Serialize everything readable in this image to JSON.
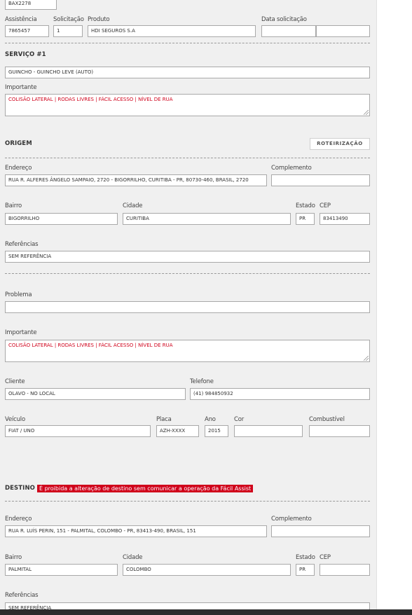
{
  "top": {
    "code": "BAX2278"
  },
  "header": {
    "assistencia_label": "Assistência",
    "assistencia_value": "7865457",
    "solicitacao_label": "Solicitação",
    "solicitacao_value": "1",
    "produto_label": "Produto",
    "produto_value": "HDI SEGUROS S.A",
    "data_label": "Data solicitação",
    "data_value_1": "",
    "data_value_2": ""
  },
  "servico": {
    "title": "SERVIÇO #1",
    "service_value": "GUINCHO - GUINCHO LEVE (AUTO)",
    "importante_label": "Importante",
    "importante_value": "COLISÃO LATERAL | RODAS LIVRES | FÁCIL ACESSO | NÍVEL DE RUA"
  },
  "origem": {
    "title": "ORIGEM",
    "route_button": "ROTEIRIZAÇÃO",
    "endereco_label": "Endereço",
    "endereco_value": "RUA R. ALFERES ÂNGELO SAMPAIO, 2720 - BIGORRILHO, CURITIBA - PR, 80730-460, BRASIL, 2720",
    "complemento_label": "Complemento",
    "complemento_value": "",
    "bairro_label": "Bairro",
    "bairro_value": "BIGORRILHO",
    "cidade_label": "Cidade",
    "cidade_value": "CURITIBA",
    "estado_label": "Estado",
    "estado_value": "PR",
    "cep_label": "CEP",
    "cep_value": "83413490",
    "referencias_label": "Referências",
    "referencias_value": "SEM REFERÊNCIA"
  },
  "problema": {
    "problema_label": "Problema",
    "problema_value": "",
    "importante_label": "Importante",
    "importante_value": "COLISÃO LATERAL | RODAS LIVRES | FÁCIL ACESSO | NÍVEL DE RUA",
    "cliente_label": "Cliente",
    "cliente_value": "OLAVO - NO LOCAL",
    "telefone_label": "Telefone",
    "telefone_value": "(41) 984850932",
    "veiculo_label": "Veículo",
    "veiculo_value": "FIAT / UNO",
    "placa_label": "Placa",
    "placa_value": "AZH-XXXX",
    "ano_label": "Ano",
    "ano_value": "2015",
    "cor_label": "Cor",
    "cor_value": "",
    "combustivel_label": "Combustível",
    "combustivel_value": ""
  },
  "destino": {
    "title": "DESTINO",
    "warning": "É proibida a alteração de destino sem comunicar a operação da Fácil Assist",
    "endereco_label": "Endereço",
    "endereco_value": "RUA R. LUÍS PERIN, 151 - PALMITAL, COLOMBO - PR, 83413-490, BRASIL, 151",
    "complemento_label": "Complemento",
    "complemento_value": "",
    "bairro_label": "Bairro",
    "bairro_value": "PALMITAL",
    "cidade_label": "Cidade",
    "cidade_value": "COLOMBO",
    "estado_label": "Estado",
    "estado_value": "PR",
    "cep_label": "CEP",
    "cep_value": "",
    "referencias_label": "Referências",
    "referencias_value": "SEM REFERÊNCIA"
  },
  "colors": {
    "panel": "#f0f0f0",
    "warning": "#d0021b",
    "important_text": "#d0021b"
  }
}
